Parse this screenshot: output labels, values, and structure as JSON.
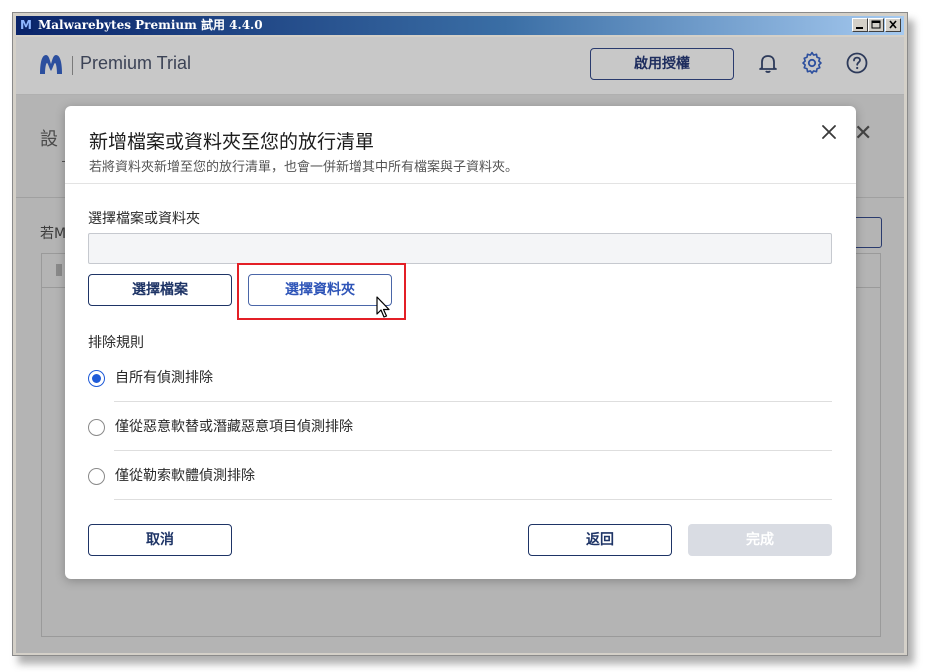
{
  "window": {
    "title": "Malwarebytes Premium 試用  4.4.0",
    "logo_letter": "M"
  },
  "app_header": {
    "brand": "Premium Trial",
    "activate_label": "啟用授權"
  },
  "background": {
    "page_title": "設定",
    "page_title_visible": "設",
    "intro_text_visible": "若M",
    "close_glyph": "✕"
  },
  "dialog": {
    "title": "新增檔案或資料夾至您的放行清單",
    "subtitle": "若將資料夾新增至您的放行清單，也會一併新增其中所有檔案與子資料夾。",
    "file_label": "選擇檔案或資料夾",
    "path_value": "",
    "choose_file_label": "選擇檔案",
    "choose_folder_label": "選擇資料夾",
    "rules_label": "排除規則",
    "rules": [
      {
        "label": "自所有偵測排除",
        "checked": true
      },
      {
        "label": "僅從惡意軟替或潛藏惡意項目偵測排除",
        "checked": false
      },
      {
        "label": "僅從勒索軟體偵測排除",
        "checked": false
      }
    ],
    "cancel_label": "取消",
    "back_label": "返回",
    "done_label": "完成"
  },
  "colors": {
    "accent_blue": "#1f5bd8",
    "navy": "#1e3466",
    "highlight_red": "#e31f26",
    "disabled_button": "#d9dce3"
  },
  "icons": [
    "malwarebytes-logo-icon",
    "bell-icon",
    "gear-icon",
    "help-icon",
    "close-icon",
    "mouse-cursor-icon"
  ]
}
